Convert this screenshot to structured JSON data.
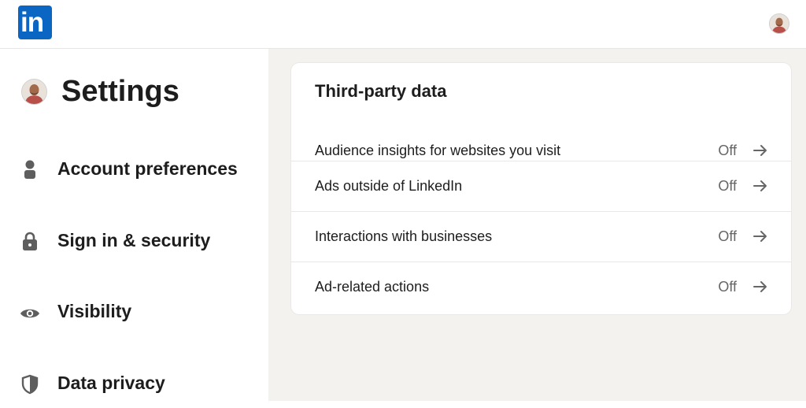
{
  "header": {
    "logo_text": "in",
    "brand_color": "#0a66c2"
  },
  "sidebar": {
    "title": "Settings",
    "items": [
      {
        "label": "Account preferences",
        "icon": "person-icon"
      },
      {
        "label": "Sign in & security",
        "icon": "lock-icon"
      },
      {
        "label": "Visibility",
        "icon": "eye-icon"
      },
      {
        "label": "Data privacy",
        "icon": "shield-icon"
      }
    ]
  },
  "card": {
    "title": "Third-party data",
    "rows": [
      {
        "label": "Audience insights for websites you visit",
        "status": "Off"
      },
      {
        "label": "Ads outside of LinkedIn",
        "status": "Off"
      },
      {
        "label": "Interactions with businesses",
        "status": "Off"
      },
      {
        "label": "Ad-related actions",
        "status": "Off"
      }
    ]
  },
  "colors": {
    "page_background": "#f3f2ef",
    "card_background": "#ffffff",
    "status_text": "#666666"
  }
}
